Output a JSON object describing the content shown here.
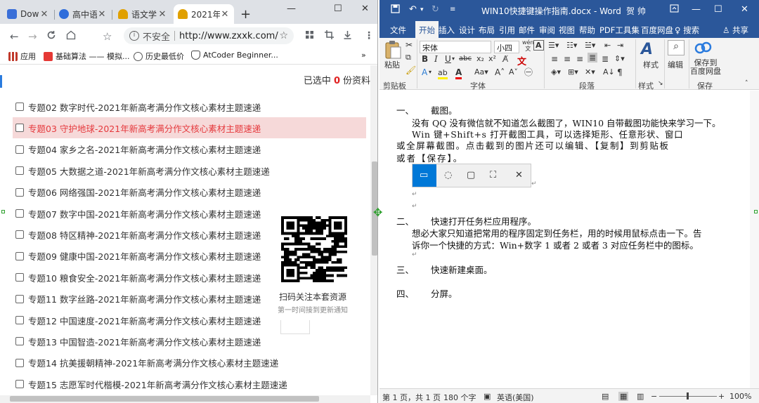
{
  "chrome": {
    "tabs": [
      {
        "title": "Downl",
        "favicon_color": "#3a6fd8"
      },
      {
        "title": "高中语",
        "favicon_color": "#2f6ddb"
      },
      {
        "title": "语文学",
        "favicon_color": "#e0a000"
      },
      {
        "title": "2021年",
        "favicon_color": "#e0a000"
      }
    ],
    "new_tab_icon": "plus-icon",
    "window_controls": {
      "minimize": "—",
      "maximize": "☐",
      "close": "✕"
    },
    "nav": {
      "back": "←",
      "forward": "→",
      "reload": "C",
      "home": "⌂"
    },
    "omnibox": {
      "security_label": "不安全",
      "url": "http://www.zxxk.com/...",
      "info_icon": "i"
    },
    "bookmarks": [
      {
        "label": "应用",
        "icon_color": "#c0392b"
      },
      {
        "label": "基础算法 —— 模拟...",
        "icon_color": "#e53935"
      },
      {
        "label": "历史最低价",
        "icon_color": "#555555"
      },
      {
        "label": "AtCoder Beginner...",
        "icon_color": "#444444"
      }
    ],
    "bookmarks_more": "»",
    "selection": {
      "prefix": "已选中",
      "count": "0",
      "suffix": "份资料"
    },
    "list_items": [
      {
        "label": "专题02 数字时代-2021年新高考满分作文核心素材主题速递",
        "highlight": false
      },
      {
        "label": "专题03 守护地球-2021年新高考满分作文核心素材主题速递",
        "highlight": true
      },
      {
        "label": "专题04 家乡之名-2021年新高考满分作文核心素材主题速递",
        "highlight": false
      },
      {
        "label": "专题05 大数据之道-2021年新高考满分作文核心素材主题速递",
        "highlight": false
      },
      {
        "label": "专题06 网络强国-2021年新高考满分作文核心素材主题速递",
        "highlight": false
      },
      {
        "label": "专题07 数字中国-2021年新高考满分作文核心素材主题速递",
        "highlight": false
      },
      {
        "label": "专题08 特区精神-2021年新高考满分作文核心素材主题速递",
        "highlight": false
      },
      {
        "label": "专题09 健康中国-2021年新高考满分作文核心素材主题速递",
        "highlight": false
      },
      {
        "label": "专题10 粮食安全-2021年新高考满分作文核心素材主题速递",
        "highlight": false
      },
      {
        "label": "专题11 数字丝路-2021年新高考满分作文核心素材主题速递",
        "highlight": false
      },
      {
        "label": "专题12 中国速度-2021年新高考满分作文核心素材主题速递",
        "highlight": false
      },
      {
        "label": "专题13 中国智造-2021年新高考满分作文核心素材主题速递",
        "highlight": false
      },
      {
        "label": "专题14 抗美援朝精神-2021年新高考满分作文核心素材主题速递",
        "highlight": false
      },
      {
        "label": "专题15 志愿军时代楷模-2021年新高考满分作文核心素材主题速递",
        "highlight": false
      }
    ],
    "qr": {
      "caption": "扫码关注本套资源",
      "subcaption": "第一时间接到更新通知"
    }
  },
  "word": {
    "doc_title": "WIN10快捷键操作指南.docx - Word",
    "user": "贺 帅",
    "ribbon_tabs": [
      "文件",
      "开始",
      "插入",
      "设计",
      "布局",
      "引用",
      "邮件",
      "审阅",
      "视图",
      "帮助",
      "PDF工具集",
      "百度网盘",
      "搜索",
      "共享"
    ],
    "active_tab": "开始",
    "font": {
      "name": "宋体",
      "size": "小四",
      "wen_label": "wén",
      "a_label": "A"
    },
    "groups": [
      "剪贴板",
      "字体",
      "段落",
      "样式",
      "保存"
    ],
    "buttons": {
      "paste": "粘贴",
      "styles": "样式",
      "edit": "编辑",
      "save_baidu_1": "保存到",
      "save_baidu_2": "百度网盘"
    },
    "document": {
      "h1": {
        "num": "一、",
        "text": "截图。"
      },
      "p1": "没有 QQ 没有微信就不知道怎么截图了，WIN10 自带截图功能快来学习一下。",
      "p2a": "Win 键+Shift+s 打开截图工具，可以选择矩形、任意形状、窗口",
      "p2b": "或全屏幕截图。点击截到的图片还可以编辑、【复制】到剪贴板",
      "p2c": "或者【保存】。",
      "h2": {
        "num": "二、",
        "text": "快速打开任务栏应用程序。"
      },
      "p3a": "想必大家只知道把常用的程序固定到任务栏，用的时候用鼠标点击一下。告",
      "p3b": "诉你一个快捷的方式：Win+数字 1 或者 2 或者 3 对应任务栏中的图标。",
      "h3": {
        "num": "三、",
        "text": "快速新建桌面。"
      },
      "h4": {
        "num": "四、",
        "text": "分屏。"
      }
    },
    "status": {
      "page": "第 1 页，共 1 页",
      "words": "180 个字",
      "lang": "英语(美国)",
      "zoom": "100%"
    }
  }
}
